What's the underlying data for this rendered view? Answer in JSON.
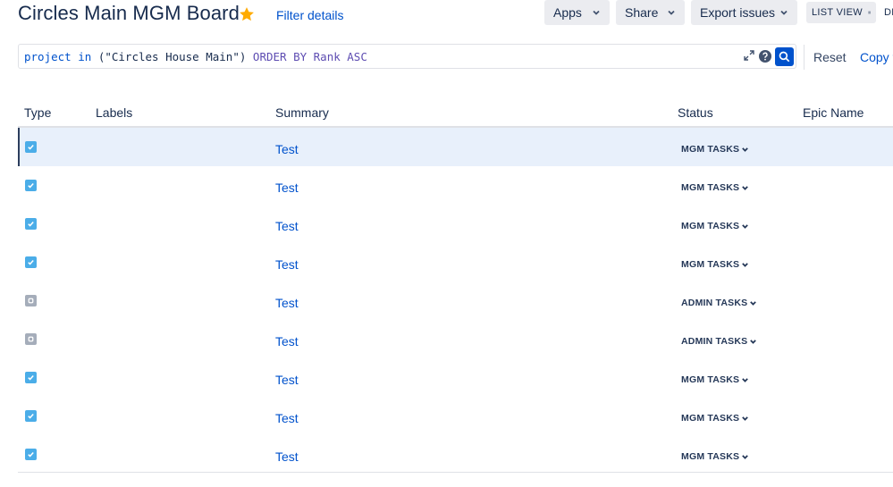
{
  "header": {
    "title": "Circles Main MGM Board",
    "filter_details": "Filter details",
    "apps": "Apps",
    "share": "Share",
    "export": "Export issues",
    "list_view": "LIST VIEW",
    "detail_view": "DE"
  },
  "query": {
    "field": "project",
    "operator": "in",
    "value": "(\"Circles House Main\")",
    "order_clause": "ORDER BY Rank ASC",
    "reset": "Reset",
    "copy": "Copy f"
  },
  "table": {
    "columns": [
      "Type",
      "Labels",
      "Summary",
      "Status",
      "Epic Name"
    ],
    "rows": [
      {
        "type": "task-icon",
        "summary": "Test",
        "status": "MGM TASKS",
        "selected": true
      },
      {
        "type": "task-icon",
        "summary": "Test",
        "status": "MGM TASKS"
      },
      {
        "type": "task-icon",
        "summary": "Test",
        "status": "MGM TASKS"
      },
      {
        "type": "task-icon",
        "summary": "Test",
        "status": "MGM TASKS"
      },
      {
        "type": "subtask-icon",
        "summary": "Test",
        "status": "ADMIN TASKS"
      },
      {
        "type": "subtask-icon",
        "summary": "Test",
        "status": "ADMIN TASKS"
      },
      {
        "type": "task-icon",
        "summary": "Test",
        "status": "MGM TASKS"
      },
      {
        "type": "task-icon",
        "summary": "Test",
        "status": "MGM TASKS"
      },
      {
        "type": "task-icon",
        "summary": "Test",
        "status": "MGM TASKS"
      }
    ]
  },
  "colors": {
    "accent": "#0052cc",
    "star": "#ffab00",
    "task": "#4bade8",
    "subtask": "#a5adba",
    "selected_row": "#e8f0fb"
  }
}
